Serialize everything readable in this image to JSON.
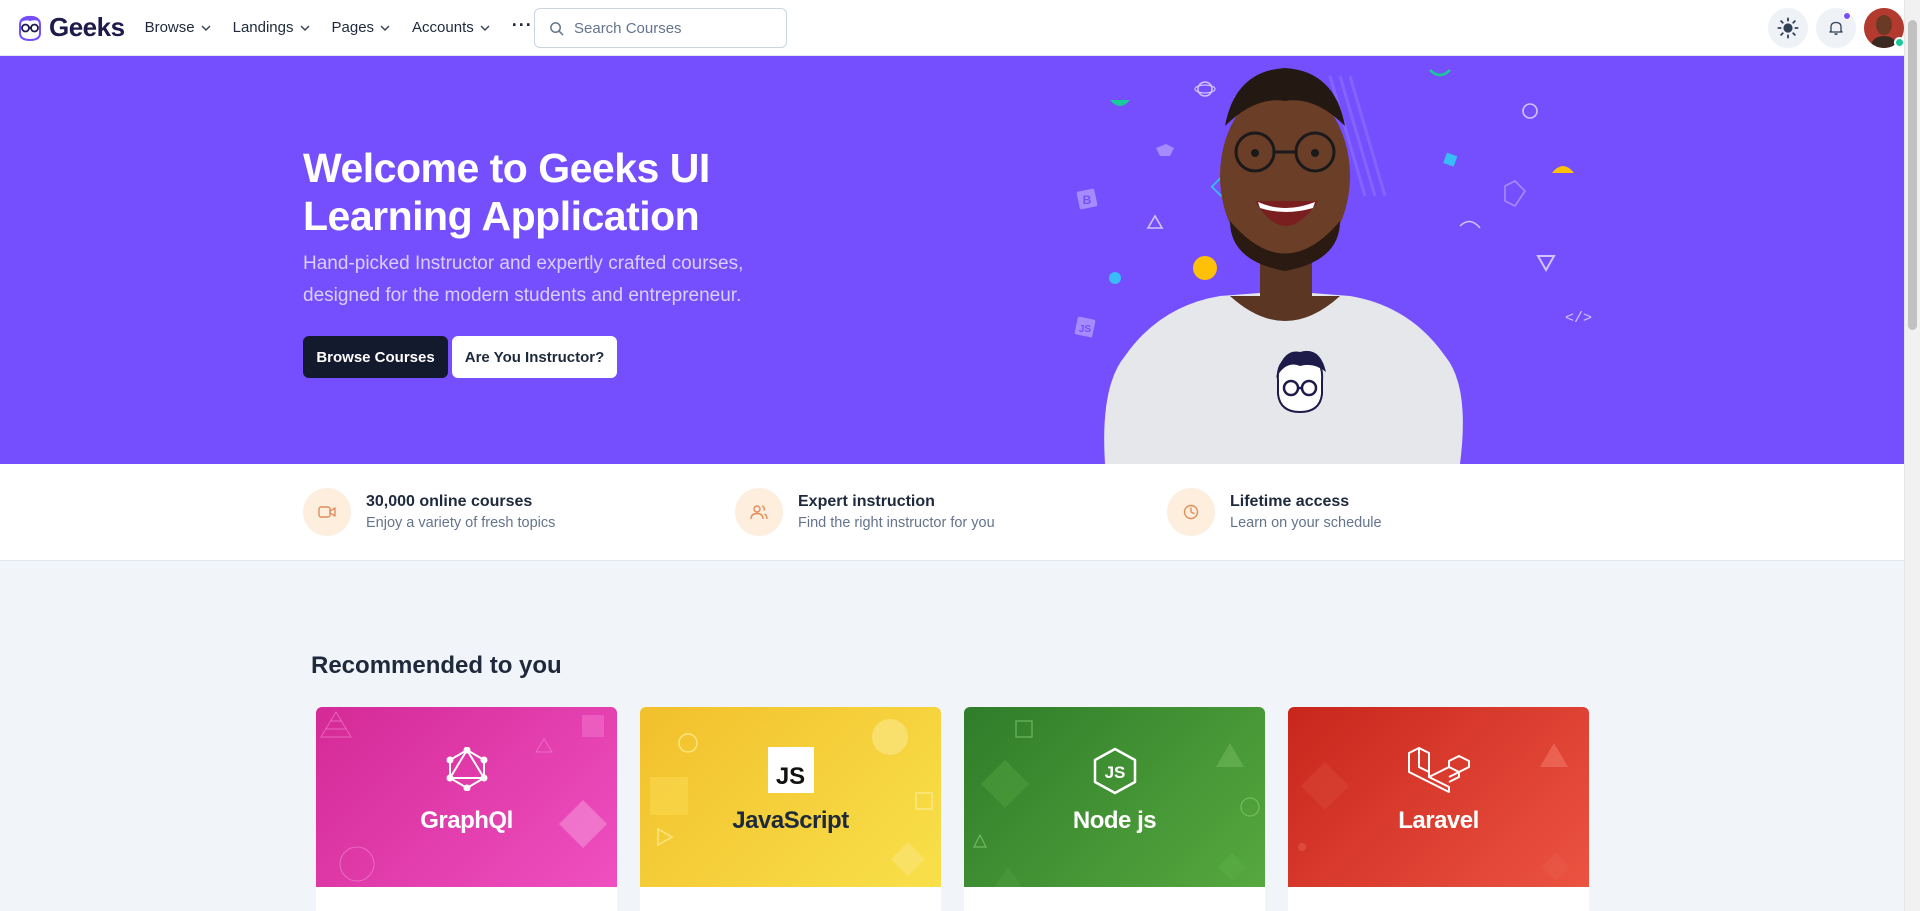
{
  "nav": {
    "brand": "Geeks",
    "menu": [
      {
        "label": "Browse"
      },
      {
        "label": "Landings"
      },
      {
        "label": "Pages"
      },
      {
        "label": "Accounts"
      }
    ],
    "more_label": "···",
    "search_placeholder": "Search Courses",
    "icons": [
      "sun-icon",
      "bell-icon",
      "avatar"
    ]
  },
  "hero": {
    "title": "Welcome to Geeks UI Learning Application",
    "subtitle": "Hand-picked Instructor and expertly crafted courses, designed for the modern students and entrepreneur.",
    "primary_button": "Browse Courses",
    "secondary_button": "Are You Instructor?",
    "background": "#754ffe"
  },
  "features": [
    {
      "title": "30,000 online courses",
      "desc": "Enjoy a variety of fresh topics",
      "icon": "video-icon"
    },
    {
      "title": "Expert instruction",
      "desc": "Find the right instructor for you",
      "icon": "users-icon"
    },
    {
      "title": "Lifetime access",
      "desc": "Learn on your schedule",
      "icon": "clock-icon"
    }
  ],
  "recommended": {
    "title": "Recommended to you",
    "courses": [
      {
        "label": "GraphQl",
        "logo_text": "",
        "color": "#e535ab"
      },
      {
        "label": "JavaScript",
        "logo_text": "JS",
        "color": "#f7df1e"
      },
      {
        "label": "Node js",
        "logo_text": "JS",
        "color": "#3c873a"
      },
      {
        "label": "Laravel",
        "logo_text": "",
        "color": "#ef3b2d"
      }
    ]
  }
}
